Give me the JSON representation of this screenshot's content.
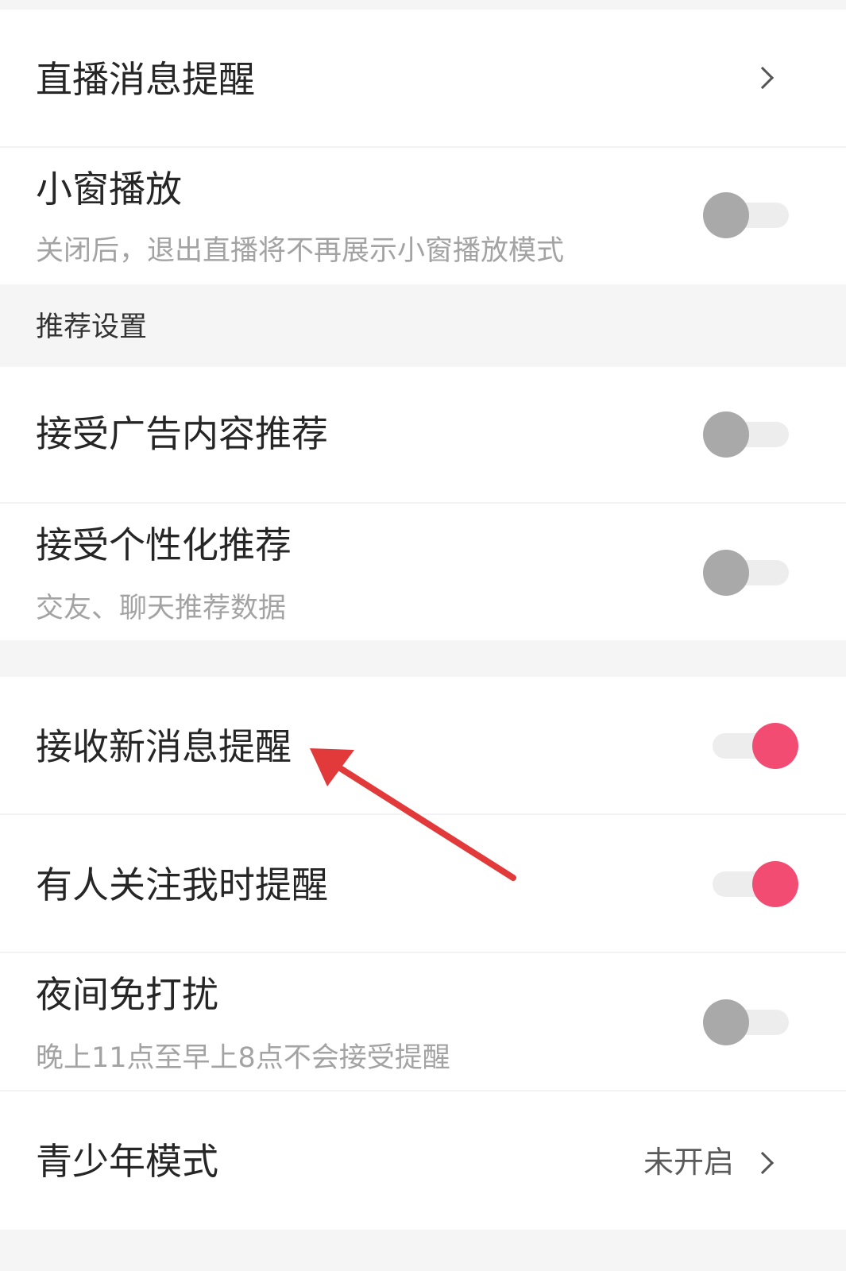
{
  "items": {
    "live_reminder": {
      "title": "直播消息提醒"
    },
    "mini_window": {
      "title": "小窗播放",
      "subtitle": "关闭后，退出直播将不再展示小窗播放模式",
      "enabled": false
    },
    "ad_recommend": {
      "title": "接受广告内容推荐",
      "enabled": false
    },
    "personalized_recommend": {
      "title": "接受个性化推荐",
      "subtitle": "交友、聊天推荐数据",
      "enabled": false
    },
    "new_message_reminder": {
      "title": "接收新消息提醒",
      "enabled": true
    },
    "follow_reminder": {
      "title": "有人关注我时提醒",
      "enabled": true
    },
    "night_dnd": {
      "title": "夜间免打扰",
      "subtitle": "晚上11点至早上8点不会接受提醒",
      "enabled": false
    },
    "teen_mode": {
      "title": "青少年模式",
      "value": "未开启"
    }
  },
  "sections": {
    "recommend": {
      "label": "推荐设置"
    }
  },
  "annotation": {
    "arrow_color": "#e23a3a"
  },
  "colors": {
    "toggle_on": "#f24c73",
    "toggle_off_knob": "#a9a9a9",
    "toggle_track": "#ededed",
    "background": "#f5f5f5"
  }
}
